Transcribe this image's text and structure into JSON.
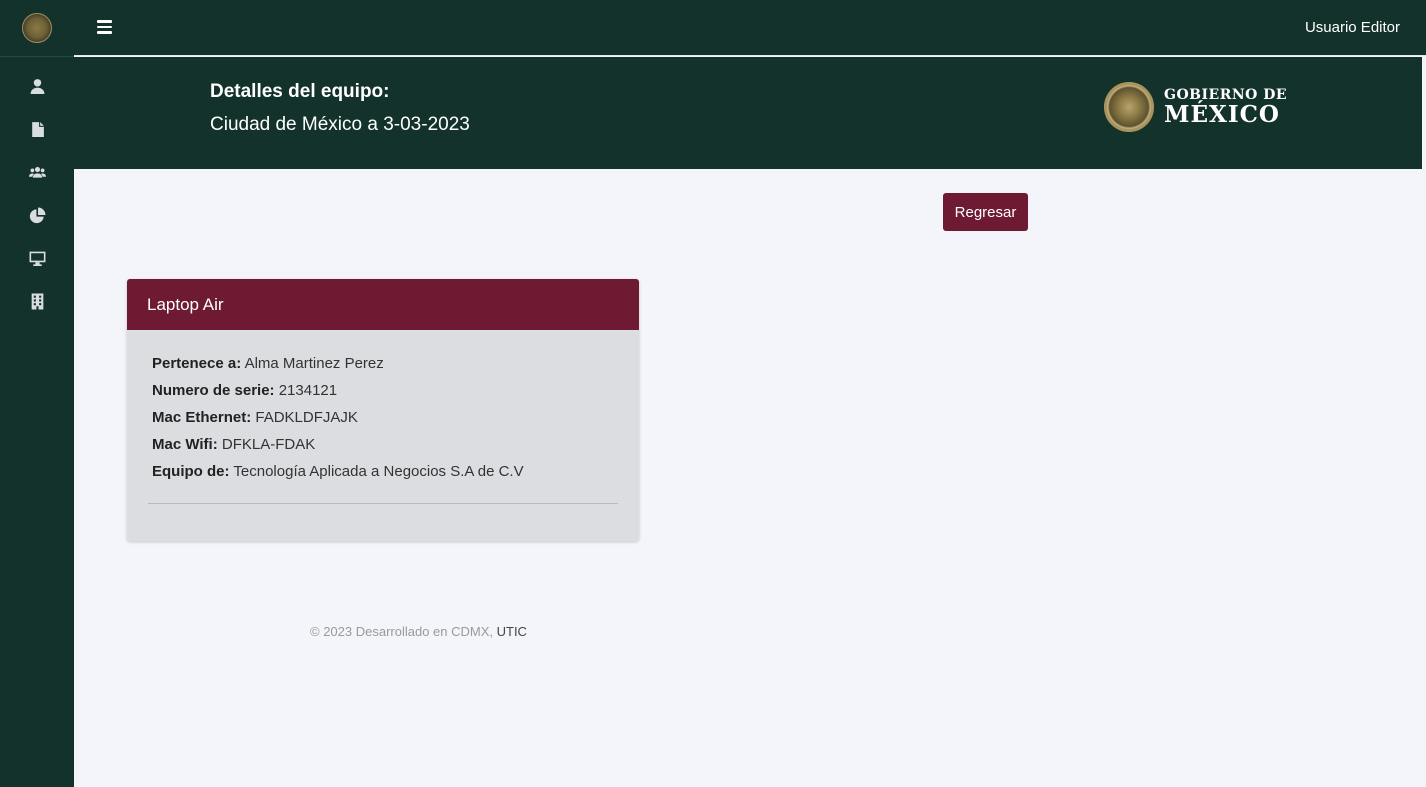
{
  "topbar": {
    "user_name": "Usuario Editor"
  },
  "sidebar": {
    "items": [
      {
        "icon": "user-icon"
      },
      {
        "icon": "document-icon"
      },
      {
        "icon": "users-icon"
      },
      {
        "icon": "pie-chart-icon"
      },
      {
        "icon": "monitor-icon"
      },
      {
        "icon": "building-icon"
      }
    ]
  },
  "header": {
    "title": "Detalles del equipo:",
    "subtitle": "Ciudad de México a 3-03-2023",
    "logo_line1": "GOBIERNO DE",
    "logo_line2": "MÉXICO"
  },
  "actions": {
    "back_label": "Regresar"
  },
  "card": {
    "title": "Laptop Air",
    "fields": [
      {
        "label": "Pertenece a:",
        "value": "Alma Martinez Perez"
      },
      {
        "label": "Numero de serie:",
        "value": "2134121"
      },
      {
        "label": "Mac Ethernet:",
        "value": "FADKLDFJAJK"
      },
      {
        "label": "Mac Wifi:",
        "value": "DFKLA-FDAK"
      },
      {
        "label": "Equipo de:",
        "value": "Tecnología Aplicada a Negocios S.A de C.V"
      }
    ]
  },
  "footer": {
    "text": "© 2023 Desarrollado en CDMX, ",
    "link": "UTIC"
  },
  "colors": {
    "primary_green": "#13322b",
    "accent_maroon": "#6f1a33",
    "background": "#f4f5fa",
    "card_body": "#dcdde1"
  }
}
